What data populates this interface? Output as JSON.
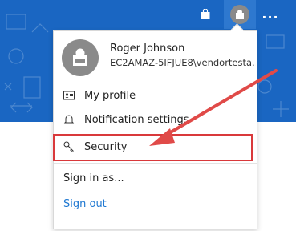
{
  "header": {
    "icons": [
      "shopping-bag-icon",
      "user-avatar-icon",
      "more-icon"
    ],
    "more_label": "..."
  },
  "profile_menu": {
    "user": {
      "name": "Roger Johnson",
      "account": "EC2AMAZ-5IFJUE8\\vendortesta..."
    },
    "items": [
      {
        "label": "My profile",
        "icon": "profile-card-icon"
      },
      {
        "label": "Notification settings",
        "icon": "bell-icon"
      },
      {
        "label": "Security",
        "icon": "key-icon",
        "highlighted": true
      },
      {
        "label": "Sign in as..."
      },
      {
        "label": "Sign out",
        "style": "link"
      }
    ]
  },
  "colors": {
    "banner": "#1a66c2",
    "highlight_box": "#d9393b",
    "arrow": "#e04a48",
    "link": "#1f78d1"
  }
}
